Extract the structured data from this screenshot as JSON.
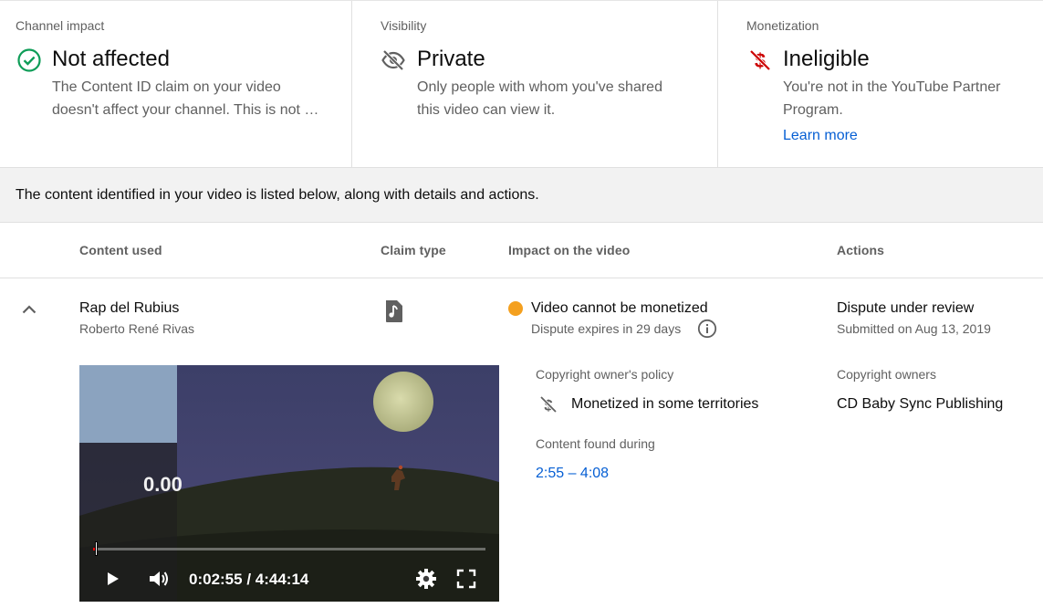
{
  "summary": {
    "channel_impact": {
      "label": "Channel impact",
      "status": "Not affected",
      "description": "The Content ID claim on your video doesn't affect your channel. This is not …",
      "icon": "check-circle-icon",
      "color": "#0f9d58"
    },
    "visibility": {
      "label": "Visibility",
      "status": "Private",
      "description": "Only people with whom you've shared this video can view it.",
      "icon": "eye-off-icon"
    },
    "monetization": {
      "label": "Monetization",
      "status": "Ineligible",
      "description": "You're not in the YouTube Partner Program.",
      "link": "Learn more",
      "icon": "no-money-icon",
      "color": "#cc0000"
    }
  },
  "banner": {
    "text": "The content identified in your video is listed below, along with details and actions."
  },
  "table": {
    "headers": {
      "content_used": "Content used",
      "claim_type": "Claim type",
      "impact": "Impact on the video",
      "actions": "Actions"
    },
    "row": {
      "title": "Rap del Rubius",
      "artist": "Roberto René Rivas",
      "claim_icon": "music-note-icon",
      "impact_title": "Video cannot be monetized",
      "impact_sub": "Dispute expires in 29 days",
      "status_color": "#f4a01f",
      "action_title": "Dispute under review",
      "action_sub": "Submitted on Aug 13, 2019"
    }
  },
  "details": {
    "policy_label": "Copyright owner's policy",
    "policy_value": "Monetized in some territories",
    "owners_label": "Copyright owners",
    "owners_value": "CD Baby Sync Publishing",
    "found_label": "Content found during",
    "found_value": "2:55 – 4:08"
  },
  "player": {
    "timecode": "0:02:55 / 4:44:14",
    "overlay_number": "0.00",
    "progress": 0.01
  }
}
